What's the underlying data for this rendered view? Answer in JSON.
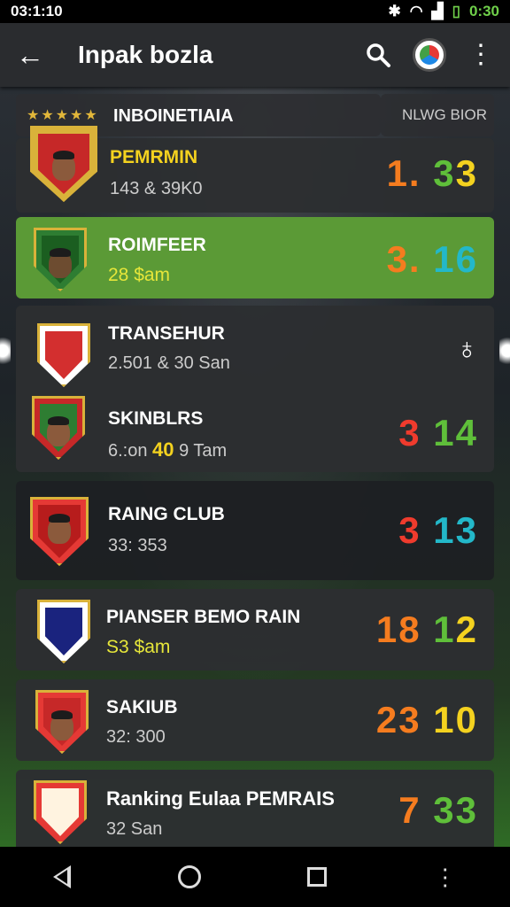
{
  "status": {
    "left_time": "03:1:10",
    "right_time": "0:30"
  },
  "app_bar": {
    "title": "Inpak bozla"
  },
  "header": {
    "league": "INBOINETIAIA",
    "right_label": "NLWG BIOR"
  },
  "rows": [
    {
      "name": "PEMRMIN",
      "sub": "143 & 39K0",
      "score": [
        "1.",
        "3",
        "3"
      ]
    },
    {
      "name": "ROIMFEER",
      "sub": "28 $am",
      "score": [
        "3.",
        "1",
        "6"
      ]
    },
    {
      "name": "TRANSEHUR",
      "sub": "2.501 & 30 San",
      "score": []
    },
    {
      "name": "SKINBLRS",
      "sub_a": "6.:on ",
      "sub_b": "40",
      "sub_c": " 9 Tam",
      "score": [
        "3",
        "1",
        "4"
      ]
    },
    {
      "name": "RAING CLUB",
      "sub": "33: 353",
      "score": [
        "3",
        "1",
        "3"
      ]
    },
    {
      "name": "PIANSER BEMO RAIN",
      "sub": "S3 $am",
      "score": [
        "18",
        "1",
        "2"
      ]
    },
    {
      "name": "SAKIUB",
      "sub": "32: 300",
      "score": [
        "23",
        "1",
        "0"
      ]
    },
    {
      "name": "Ranking Eulaa PEMRAIS",
      "sub": "32 San",
      "score": [
        "7",
        "3",
        "3"
      ]
    }
  ],
  "colors": {
    "highlight": "#5b9a36",
    "card": "#2c2e31",
    "accent_gold": "#d9b23a"
  },
  "icons": [
    "back-arrow-icon",
    "search-icon",
    "chrome-logo-icon",
    "more-vert-icon",
    "whistle-icon"
  ]
}
